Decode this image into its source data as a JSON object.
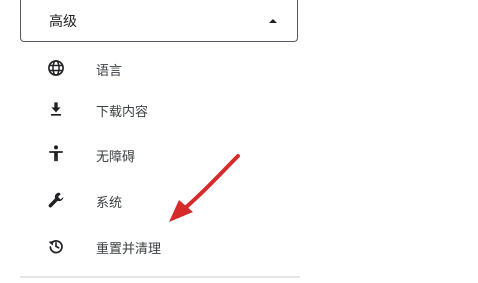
{
  "section": {
    "title": "高级",
    "expanded_icon": "caret-up-icon"
  },
  "menu": {
    "items": [
      {
        "label": "语言",
        "icon": "globe-icon"
      },
      {
        "label": "下载内容",
        "icon": "download-icon"
      },
      {
        "label": "无障碍",
        "icon": "accessibility-icon"
      },
      {
        "label": "系统",
        "icon": "wrench-icon"
      },
      {
        "label": "重置并清理",
        "icon": "restore-icon"
      }
    ]
  },
  "annotation": {
    "icon": "red-arrow-icon",
    "color": "#d62b2b"
  },
  "colors": {
    "border": "#555a60",
    "text": "#202124",
    "icon": "#202124",
    "divider": "#e6e6e6"
  }
}
